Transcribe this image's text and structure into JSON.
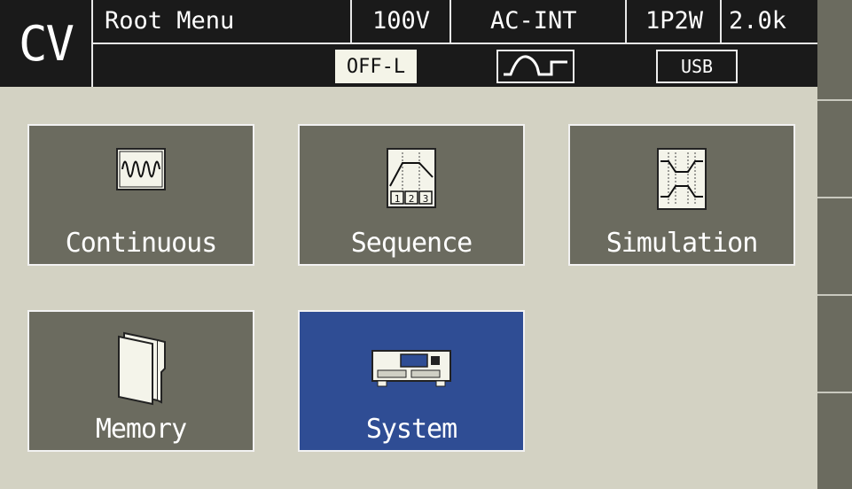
{
  "header": {
    "mode": "CV",
    "title": "Root Menu",
    "voltage_range": "100V",
    "source": "AC-INT",
    "wiring": "1P2W",
    "current": "2.0k",
    "output_state": "OFF-L",
    "waveform_icon": "ac-square-wave-icon",
    "interface": "USB"
  },
  "menu": {
    "items": [
      {
        "label": "Continuous",
        "icon": "continuous-waveform-icon",
        "selected": false
      },
      {
        "label": "Sequence",
        "icon": "sequence-steps-icon",
        "selected": false
      },
      {
        "label": "Simulation",
        "icon": "simulation-icon",
        "selected": false
      },
      {
        "label": "Memory",
        "icon": "folder-icon",
        "selected": false
      },
      {
        "label": "System",
        "icon": "instrument-icon",
        "selected": true
      }
    ]
  },
  "colors": {
    "background": "#d3d2c3",
    "tile": "#6b6b5f",
    "tile_selected": "#2f4d94",
    "header": "#1a1a1a"
  }
}
